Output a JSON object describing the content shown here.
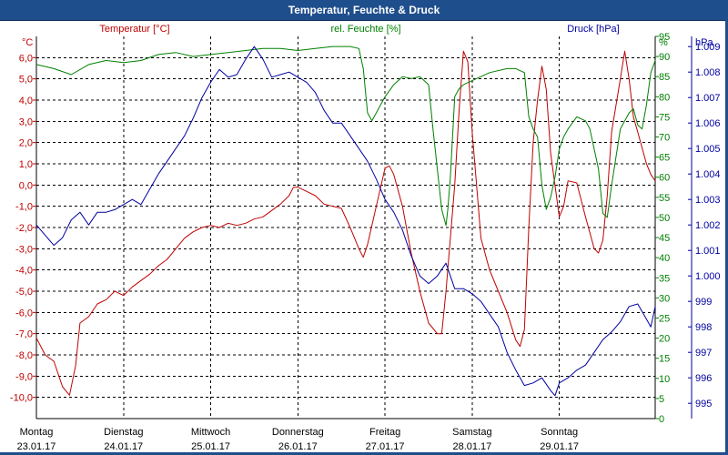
{
  "window": {
    "title": "Temperatur, Feuchte & Druck"
  },
  "colors": {
    "temperature": "#c00000",
    "humidity": "#008000",
    "pressure": "#0000a0",
    "grid": "#000000",
    "title_bar": "#1f4e8c"
  },
  "chart_data": {
    "type": "line",
    "title": "Temperatur, Feuchte & Druck",
    "grid": true,
    "x_ticks": [
      {
        "day": "Montag",
        "date": "23.01.17"
      },
      {
        "day": "Dienstag",
        "date": "24.01.17"
      },
      {
        "day": "Mittwoch",
        "date": "25.01.17"
      },
      {
        "day": "Donnerstag",
        "date": "26.01.17"
      },
      {
        "day": "Freitag",
        "date": "27.01.17"
      },
      {
        "day": "Samstag",
        "date": "28.01.17"
      },
      {
        "day": "Sonntag",
        "date": "29.01.17"
      }
    ],
    "x_range_days": [
      0,
      7.1
    ],
    "axes": {
      "temperature": {
        "label": "Temperatur [°C]",
        "unit": "°C",
        "ylim": [
          -11,
          7
        ],
        "ticks": [
          "6,0",
          "5,0",
          "4,0",
          "3,0",
          "2,0",
          "1,0",
          "0,0",
          "-1,0",
          "-2,0",
          "-3,0",
          "-4,0",
          "-5,0",
          "-6,0",
          "-7,0",
          "-8,0",
          "-9,0",
          "-10,0"
        ]
      },
      "humidity": {
        "label": "rel. Feuchte [%]",
        "unit": "%",
        "ylim": [
          0,
          95
        ],
        "ticks": [
          "95",
          "90",
          "85",
          "80",
          "75",
          "70",
          "65",
          "60",
          "55",
          "50",
          "45",
          "40",
          "35",
          "30",
          "25",
          "20",
          "15",
          "10",
          "5",
          "0"
        ]
      },
      "pressure": {
        "label": "Druck [hPa]",
        "unit": "hPa",
        "ylim": [
          994.4,
          1009.4
        ],
        "ticks": [
          "1.009",
          "1.008",
          "1.007",
          "1.006",
          "1.005",
          "1.004",
          "1.003",
          "1.002",
          "1.001",
          "1.000",
          "999",
          "998",
          "997",
          "996",
          "995"
        ]
      }
    },
    "series": [
      {
        "name": "Temperatur [°C]",
        "axis": "temperature",
        "points": [
          [
            0,
            -7.2
          ],
          [
            0.1,
            -8.0
          ],
          [
            0.2,
            -8.3
          ],
          [
            0.3,
            -9.5
          ],
          [
            0.38,
            -9.9
          ],
          [
            0.45,
            -8.5
          ],
          [
            0.5,
            -6.5
          ],
          [
            0.6,
            -6.2
          ],
          [
            0.7,
            -5.6
          ],
          [
            0.8,
            -5.4
          ],
          [
            0.9,
            -5.0
          ],
          [
            1.0,
            -5.2
          ],
          [
            1.1,
            -4.8
          ],
          [
            1.2,
            -4.5
          ],
          [
            1.3,
            -4.2
          ],
          [
            1.4,
            -3.8
          ],
          [
            1.5,
            -3.5
          ],
          [
            1.6,
            -3.0
          ],
          [
            1.7,
            -2.5
          ],
          [
            1.8,
            -2.2
          ],
          [
            1.9,
            -2.0
          ],
          [
            2.0,
            -1.9
          ],
          [
            2.1,
            -2.0
          ],
          [
            2.2,
            -1.8
          ],
          [
            2.3,
            -1.9
          ],
          [
            2.4,
            -1.8
          ],
          [
            2.5,
            -1.6
          ],
          [
            2.6,
            -1.5
          ],
          [
            2.7,
            -1.2
          ],
          [
            2.8,
            -0.9
          ],
          [
            2.9,
            -0.5
          ],
          [
            2.95,
            -0.1
          ],
          [
            3.0,
            -0.1
          ],
          [
            3.1,
            -0.3
          ],
          [
            3.2,
            -0.5
          ],
          [
            3.3,
            -0.9
          ],
          [
            3.4,
            -1.0
          ],
          [
            3.5,
            -1.1
          ],
          [
            3.6,
            -2.0
          ],
          [
            3.7,
            -3.0
          ],
          [
            3.75,
            -3.4
          ],
          [
            3.8,
            -2.8
          ],
          [
            3.9,
            -1.0
          ],
          [
            4.0,
            0.8
          ],
          [
            4.05,
            0.9
          ],
          [
            4.1,
            0.5
          ],
          [
            4.2,
            -1.0
          ],
          [
            4.3,
            -3.2
          ],
          [
            4.4,
            -5.0
          ],
          [
            4.5,
            -6.5
          ],
          [
            4.6,
            -7.0
          ],
          [
            4.65,
            -7.0
          ],
          [
            4.7,
            -5.0
          ],
          [
            4.8,
            0.0
          ],
          [
            4.85,
            3.5
          ],
          [
            4.9,
            6.3
          ],
          [
            4.95,
            5.8
          ],
          [
            5.0,
            2.5
          ],
          [
            5.1,
            -2.5
          ],
          [
            5.2,
            -4.0
          ],
          [
            5.3,
            -5.0
          ],
          [
            5.4,
            -6.0
          ],
          [
            5.5,
            -7.3
          ],
          [
            5.55,
            -7.6
          ],
          [
            5.6,
            -6.8
          ],
          [
            5.65,
            -2.0
          ],
          [
            5.7,
            2.0
          ],
          [
            5.75,
            4.0
          ],
          [
            5.8,
            5.6
          ],
          [
            5.85,
            4.5
          ],
          [
            5.9,
            1.5
          ],
          [
            6.0,
            -1.5
          ],
          [
            6.05,
            -1.0
          ],
          [
            6.1,
            0.2
          ],
          [
            6.2,
            0.1
          ],
          [
            6.3,
            -1.5
          ],
          [
            6.4,
            -3.0
          ],
          [
            6.45,
            -3.2
          ],
          [
            6.5,
            -2.6
          ],
          [
            6.55,
            -0.5
          ],
          [
            6.6,
            2.5
          ],
          [
            6.7,
            5.0
          ],
          [
            6.75,
            6.3
          ],
          [
            6.8,
            5.0
          ],
          [
            6.85,
            3.2
          ],
          [
            6.9,
            2.5
          ],
          [
            7.0,
            1.0
          ],
          [
            7.05,
            0.5
          ],
          [
            7.1,
            0.2
          ]
        ]
      },
      {
        "name": "rel. Feuchte [%]",
        "axis": "humidity",
        "points": [
          [
            0,
            88
          ],
          [
            0.2,
            87
          ],
          [
            0.4,
            85.5
          ],
          [
            0.6,
            88
          ],
          [
            0.8,
            89
          ],
          [
            1.0,
            88.5
          ],
          [
            1.2,
            89
          ],
          [
            1.4,
            90.5
          ],
          [
            1.6,
            91
          ],
          [
            1.8,
            90
          ],
          [
            2.0,
            90.5
          ],
          [
            2.2,
            91
          ],
          [
            2.4,
            91.5
          ],
          [
            2.6,
            92
          ],
          [
            2.8,
            92
          ],
          [
            3.0,
            91.5
          ],
          [
            3.2,
            92
          ],
          [
            3.4,
            92.5
          ],
          [
            3.6,
            92.5
          ],
          [
            3.7,
            92
          ],
          [
            3.75,
            87
          ],
          [
            3.8,
            76
          ],
          [
            3.85,
            74
          ],
          [
            3.9,
            76
          ],
          [
            4.0,
            80
          ],
          [
            4.1,
            83
          ],
          [
            4.2,
            85
          ],
          [
            4.3,
            84.5
          ],
          [
            4.4,
            85
          ],
          [
            4.5,
            83
          ],
          [
            4.55,
            72
          ],
          [
            4.6,
            62
          ],
          [
            4.65,
            52
          ],
          [
            4.7,
            48
          ],
          [
            4.72,
            52
          ],
          [
            4.75,
            60
          ],
          [
            4.8,
            80
          ],
          [
            4.85,
            82
          ],
          [
            4.9,
            83
          ],
          [
            5.0,
            84
          ],
          [
            5.2,
            86
          ],
          [
            5.4,
            87
          ],
          [
            5.5,
            87
          ],
          [
            5.6,
            86
          ],
          [
            5.65,
            75
          ],
          [
            5.7,
            72
          ],
          [
            5.75,
            70
          ],
          [
            5.8,
            58
          ],
          [
            5.85,
            52
          ],
          [
            5.9,
            55
          ],
          [
            5.95,
            60
          ],
          [
            6.0,
            67
          ],
          [
            6.05,
            70
          ],
          [
            6.1,
            72
          ],
          [
            6.2,
            75
          ],
          [
            6.3,
            74
          ],
          [
            6.35,
            72
          ],
          [
            6.45,
            62
          ],
          [
            6.5,
            51
          ],
          [
            6.55,
            50
          ],
          [
            6.6,
            58
          ],
          [
            6.7,
            72
          ],
          [
            6.8,
            76
          ],
          [
            6.85,
            77
          ],
          [
            6.9,
            73
          ],
          [
            6.95,
            72
          ],
          [
            7.0,
            78
          ],
          [
            7.05,
            86
          ],
          [
            7.1,
            89
          ]
        ]
      },
      {
        "name": "Druck [hPa]",
        "axis": "pressure",
        "points": [
          [
            0,
            1002
          ],
          [
            0.1,
            1001.6
          ],
          [
            0.2,
            1001.2
          ],
          [
            0.3,
            1001.5
          ],
          [
            0.4,
            1002.2
          ],
          [
            0.5,
            1002.5
          ],
          [
            0.6,
            1002.0
          ],
          [
            0.7,
            1002.5
          ],
          [
            0.8,
            1002.5
          ],
          [
            0.9,
            1002.6
          ],
          [
            1.0,
            1002.8
          ],
          [
            1.1,
            1003.0
          ],
          [
            1.2,
            1002.8
          ],
          [
            1.3,
            1003.4
          ],
          [
            1.4,
            1004.0
          ],
          [
            1.5,
            1004.5
          ],
          [
            1.6,
            1005.0
          ],
          [
            1.7,
            1005.5
          ],
          [
            1.8,
            1006.2
          ],
          [
            1.9,
            1007.0
          ],
          [
            2.0,
            1007.6
          ],
          [
            2.1,
            1008.1
          ],
          [
            2.2,
            1007.8
          ],
          [
            2.3,
            1007.9
          ],
          [
            2.4,
            1008.5
          ],
          [
            2.5,
            1009.0
          ],
          [
            2.6,
            1008.5
          ],
          [
            2.7,
            1007.8
          ],
          [
            2.8,
            1007.9
          ],
          [
            2.9,
            1008.0
          ],
          [
            3.0,
            1007.8
          ],
          [
            3.1,
            1007.6
          ],
          [
            3.2,
            1007.2
          ],
          [
            3.3,
            1006.5
          ],
          [
            3.4,
            1006.0
          ],
          [
            3.5,
            1006.0
          ],
          [
            3.6,
            1005.5
          ],
          [
            3.7,
            1005.0
          ],
          [
            3.8,
            1004.5
          ],
          [
            3.9,
            1003.8
          ],
          [
            4.0,
            1003.0
          ],
          [
            4.1,
            1002.5
          ],
          [
            4.2,
            1001.8
          ],
          [
            4.3,
            1000.8
          ],
          [
            4.4,
            1000.0
          ],
          [
            4.5,
            999.7
          ],
          [
            4.6,
            1000.0
          ],
          [
            4.7,
            1000.5
          ],
          [
            4.8,
            999.5
          ],
          [
            4.9,
            999.5
          ],
          [
            5.0,
            999.3
          ],
          [
            5.1,
            999.0
          ],
          [
            5.2,
            998.5
          ],
          [
            5.3,
            998.0
          ],
          [
            5.4,
            997.0
          ],
          [
            5.5,
            996.3
          ],
          [
            5.6,
            995.7
          ],
          [
            5.7,
            995.8
          ],
          [
            5.8,
            996.0
          ],
          [
            5.9,
            995.5
          ],
          [
            5.95,
            995.3
          ],
          [
            6.0,
            995.8
          ],
          [
            6.1,
            996.0
          ],
          [
            6.2,
            996.3
          ],
          [
            6.3,
            996.5
          ],
          [
            6.4,
            997.0
          ],
          [
            6.5,
            997.5
          ],
          [
            6.6,
            997.8
          ],
          [
            6.7,
            998.2
          ],
          [
            6.8,
            998.8
          ],
          [
            6.9,
            998.9
          ],
          [
            7.0,
            998.3
          ],
          [
            7.05,
            998.0
          ],
          [
            7.1,
            998.8
          ]
        ]
      }
    ]
  }
}
